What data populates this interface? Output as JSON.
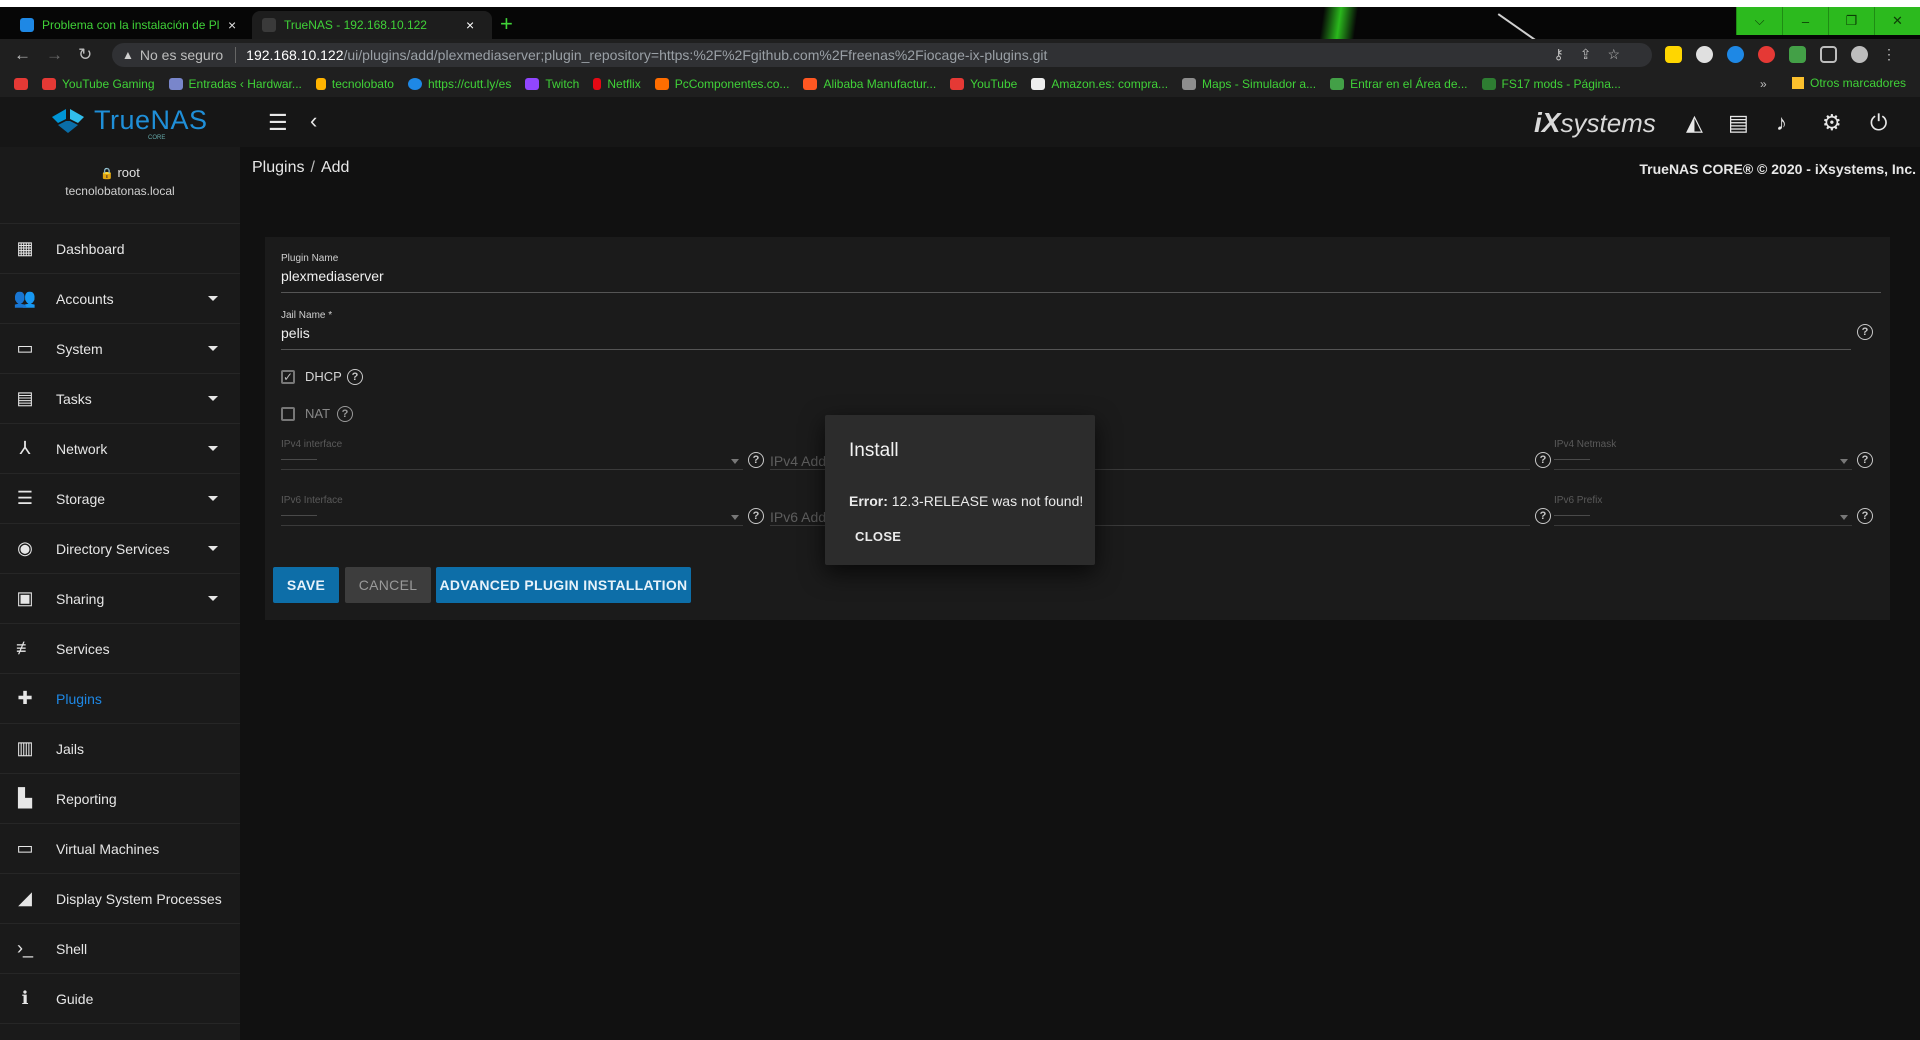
{
  "browser": {
    "tabs": [
      {
        "title": "Problema con la instalación de Pl",
        "close": "×",
        "active": false,
        "favicon_color": "#1e88e5"
      },
      {
        "title": "TrueNAS - 192.168.10.122",
        "close": "×",
        "active": true,
        "favicon_color": "#3a3a3a"
      }
    ],
    "new_tab": "+",
    "window_controls": [
      "⌵",
      "–",
      "❐",
      "✕"
    ],
    "insecure_label": "No es seguro",
    "url_host": "192.168.10.122",
    "url_path": "/ui/plugins/add/plexmediaserver;plugin_repository=https:%2F%2Fgithub.com%2Ffreenas%2Fiocage-ix-plugins.git",
    "bookmarks": [
      {
        "label": "YouTube Gaming",
        "icon_color": "#e53935"
      },
      {
        "label": "Entradas ‹ Hardwar...",
        "icon_color": "#7986cb"
      },
      {
        "label": "tecnolobato",
        "icon_color": "#ffb300"
      },
      {
        "label": "https://cutt.ly/es",
        "icon_color": "#1e88e5"
      },
      {
        "label": "Twitch",
        "icon_color": "#9146ff"
      },
      {
        "label": "Netflix",
        "icon_color": "#e50914"
      },
      {
        "label": "PcComponentes.co...",
        "icon_color": "#ff6d00"
      },
      {
        "label": "Alibaba Manufactur...",
        "icon_color": "#ff5722"
      },
      {
        "label": "YouTube",
        "icon_color": "#e53935"
      },
      {
        "label": "Amazon.es: compra...",
        "icon_color": "#eeeeee"
      },
      {
        "label": "Maps - Simulador a...",
        "icon_color": "#8d8d8d"
      },
      {
        "label": "Entrar en el Área de...",
        "icon_color": "#43a047"
      },
      {
        "label": "FS17 mods - Página...",
        "icon_color": "#2e7d32"
      }
    ],
    "bookmarks_more": "»",
    "other_bookmarks": "Otros marcadores"
  },
  "app": {
    "brand": "TrueNAS",
    "brand_sub": "CORE",
    "vendor": "systems",
    "user": "root",
    "hostname": "tecnolobatonas.local",
    "breadcrumb": [
      "Plugins",
      "Add"
    ],
    "copyright": "TrueNAS CORE® © 2020 - iXsystems, Inc.",
    "nav": [
      {
        "label": "Dashboard",
        "icon": "▦",
        "expandable": false
      },
      {
        "label": "Accounts",
        "icon": "👥",
        "expandable": true
      },
      {
        "label": "System",
        "icon": "▭",
        "expandable": true
      },
      {
        "label": "Tasks",
        "icon": "▤",
        "expandable": true
      },
      {
        "label": "Network",
        "icon": "⅄",
        "expandable": true
      },
      {
        "label": "Storage",
        "icon": "☰",
        "expandable": true
      },
      {
        "label": "Directory Services",
        "icon": "◉",
        "expandable": true
      },
      {
        "label": "Sharing",
        "icon": "▣",
        "expandable": true
      },
      {
        "label": "Services",
        "icon": "≢",
        "expandable": false
      },
      {
        "label": "Plugins",
        "icon": "✚",
        "expandable": false,
        "active": true
      },
      {
        "label": "Jails",
        "icon": "▥",
        "expandable": false
      },
      {
        "label": "Reporting",
        "icon": "▙",
        "expandable": false
      },
      {
        "label": "Virtual Machines",
        "icon": "▭",
        "expandable": false
      },
      {
        "label": "Display System Processes",
        "icon": "◢",
        "expandable": false
      },
      {
        "label": "Shell",
        "icon": "›_",
        "expandable": false
      },
      {
        "label": "Guide",
        "icon": "ℹ",
        "expandable": false
      }
    ]
  },
  "form": {
    "plugin_name_label": "Plugin Name",
    "plugin_name_value": "plexmediaserver",
    "jail_name_label": "Jail Name *",
    "jail_name_value": "pelis",
    "dhcp_label": "DHCP",
    "dhcp_checked": true,
    "nat_label": "NAT",
    "nat_checked": false,
    "ipv4_interface_label": "IPv4 interface",
    "ipv4_address_placeholder": "IPv4 Address",
    "ipv4_netmask_label": "IPv4 Netmask",
    "ipv6_interface_label": "IPv6 Interface",
    "ipv6_address_placeholder": "IPv6 Add",
    "ipv6_prefix_label": "IPv6 Prefix",
    "help_glyph": "?",
    "save": "SAVE",
    "cancel": "CANCEL",
    "advanced": "ADVANCED PLUGIN INSTALLATION"
  },
  "dialog": {
    "title": "Install",
    "error_label": "Error:",
    "error_message": "12.3-RELEASE was not found!",
    "close": "CLOSE"
  },
  "colors": {
    "accent": "#0d6ea8",
    "active_nav": "#1e88e5",
    "browser_accent": "#40d238"
  }
}
